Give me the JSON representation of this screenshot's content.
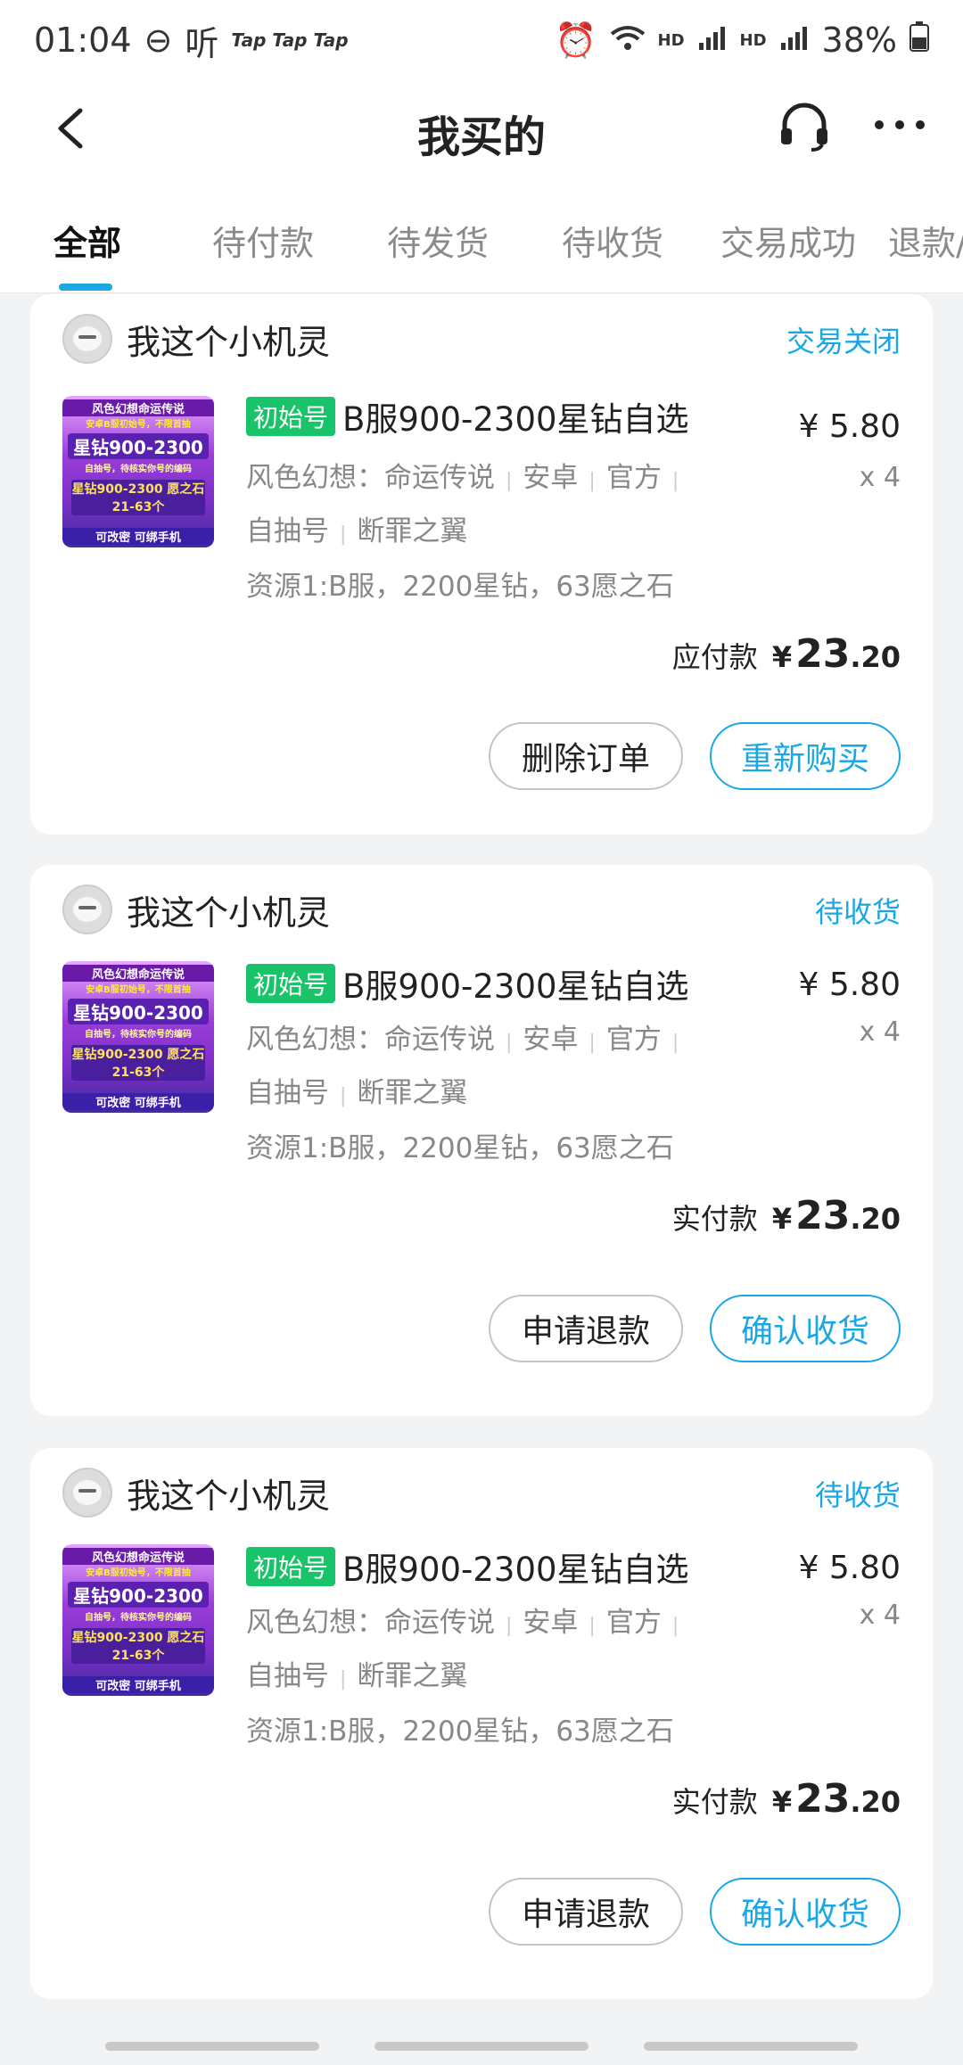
{
  "statusbar": {
    "time": "01:04",
    "carrier_extra": "Tap Tap Tap",
    "ting": "听",
    "hd1": "HD",
    "hd2": "HD",
    "battery": "38%"
  },
  "navbar": {
    "title": "我买的"
  },
  "tabs": [
    "全部",
    "待付款",
    "待发货",
    "待收货",
    "交易成功",
    "退款/"
  ],
  "orders": [
    {
      "shop": "我这个小机灵",
      "status": "交易关闭",
      "tag": "初始号",
      "title": "B服900-2300星钻自选",
      "price": "¥ 5.80",
      "qty": "x 4",
      "attrs_line1": [
        "风色幻想：命运传说",
        "安卓",
        "官方"
      ],
      "attrs_line2": [
        "自抽号",
        "断罪之翼"
      ],
      "resource": "资源1:B服，2200星钻，63愿之石",
      "total_label": "应付款",
      "total_symbol": "¥",
      "total_int": "23",
      "total_dec": ".20",
      "btn_left": "删除订单",
      "btn_right": "重新购买"
    },
    {
      "shop": "我这个小机灵",
      "status": "待收货",
      "tag": "初始号",
      "title": "B服900-2300星钻自选",
      "price": "¥ 5.80",
      "qty": "x 4",
      "attrs_line1": [
        "风色幻想：命运传说",
        "安卓",
        "官方"
      ],
      "attrs_line2": [
        "自抽号",
        "断罪之翼"
      ],
      "resource": "资源1:B服，2200星钻，63愿之石",
      "total_label": "实付款",
      "total_symbol": "¥",
      "total_int": "23",
      "total_dec": ".20",
      "btn_left": "申请退款",
      "btn_right": "确认收货"
    },
    {
      "shop": "我这个小机灵",
      "status": "待收货",
      "tag": "初始号",
      "title": "B服900-2300星钻自选",
      "price": "¥ 5.80",
      "qty": "x 4",
      "attrs_line1": [
        "风色幻想：命运传说",
        "安卓",
        "官方"
      ],
      "attrs_line2": [
        "自抽号",
        "断罪之翼"
      ],
      "resource": "资源1:B服，2200星钻，63愿之石",
      "total_label": "实付款",
      "total_symbol": "¥",
      "total_int": "23",
      "total_dec": ".20",
      "btn_left": "申请退款",
      "btn_right": "确认收货"
    }
  ],
  "thumbnail": {
    "line1": "风色幻想命运传说",
    "line2": "安卓B服初始号，不限首抽",
    "line3": "星钻900-2300",
    "line4": "自抽号，待核实你号的编码",
    "line5": "星钻900-2300 愿之石21-63个",
    "line6": "可改密 可绑手机"
  },
  "colors": {
    "accent": "#1aa7e6",
    "tag_green": "#19c36a"
  }
}
